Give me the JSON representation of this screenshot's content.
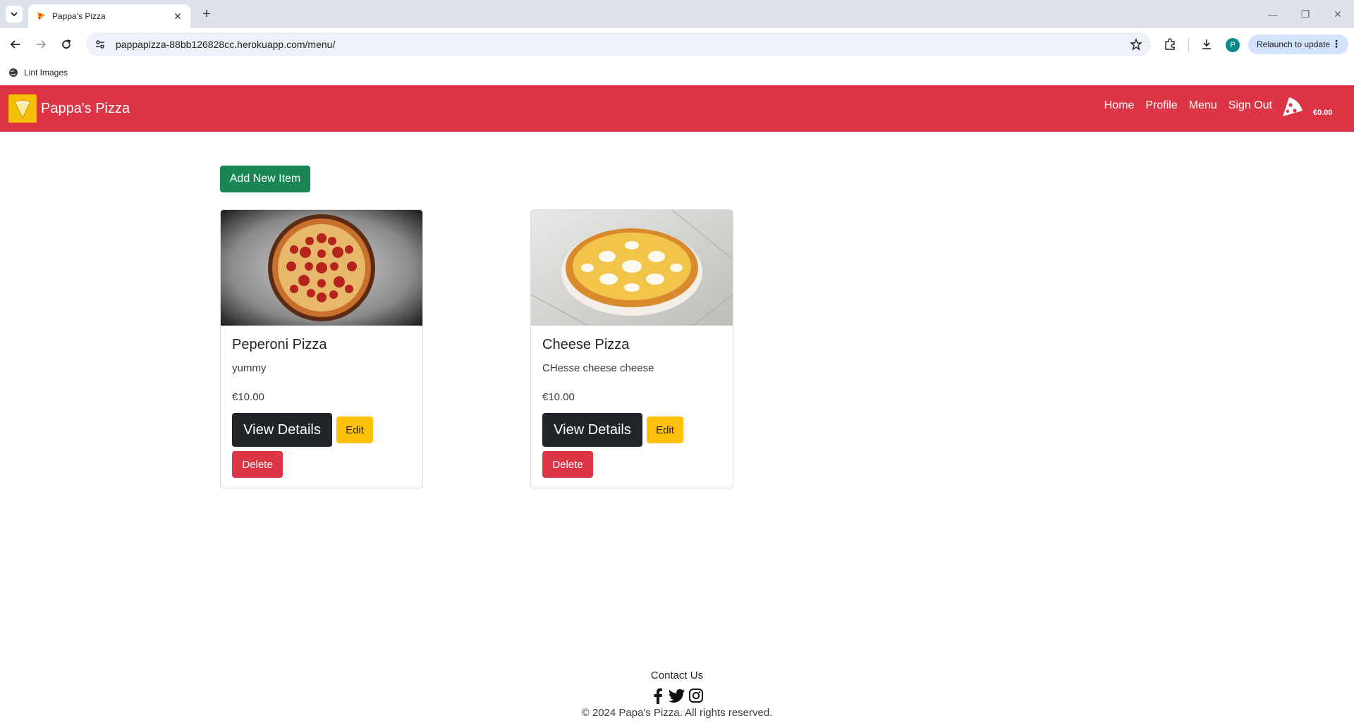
{
  "browser": {
    "tab_title": "Pappa's Pizza",
    "url": "pappapizza-88bb126828cc.herokuapp.com/menu/",
    "relaunch_label": "Relaunch to update",
    "profile_initial": "P",
    "bookmarks": [
      {
        "label": "Lint Images"
      }
    ]
  },
  "site": {
    "brand": "Pappa's Pizza",
    "nav": [
      "Home",
      "Profile",
      "Menu",
      "Sign Out"
    ],
    "cart_total": "€0.00"
  },
  "main": {
    "add_button": "Add New Item",
    "items": [
      {
        "title": "Peperoni Pizza",
        "description": "yummy",
        "price": "€10.00",
        "view_label": "View Details",
        "edit_label": "Edit",
        "delete_label": "Delete"
      },
      {
        "title": "Cheese Pizza",
        "description": "CHesse cheese cheese",
        "price": "€10.00",
        "view_label": "View Details",
        "edit_label": "Edit",
        "delete_label": "Delete"
      }
    ]
  },
  "footer": {
    "contact": "Contact Us",
    "socials": [
      "facebook-icon",
      "twitter-icon",
      "instagram-icon"
    ],
    "copyright": "© 2024 Papa's Pizza. All rights reserved."
  },
  "colors": {
    "navbar": "#dc3545",
    "add_button": "#198754",
    "view_button": "#212529",
    "edit_button": "#ffc107",
    "delete_button": "#dc3545",
    "brand_logo_bg": "#f5c000"
  }
}
